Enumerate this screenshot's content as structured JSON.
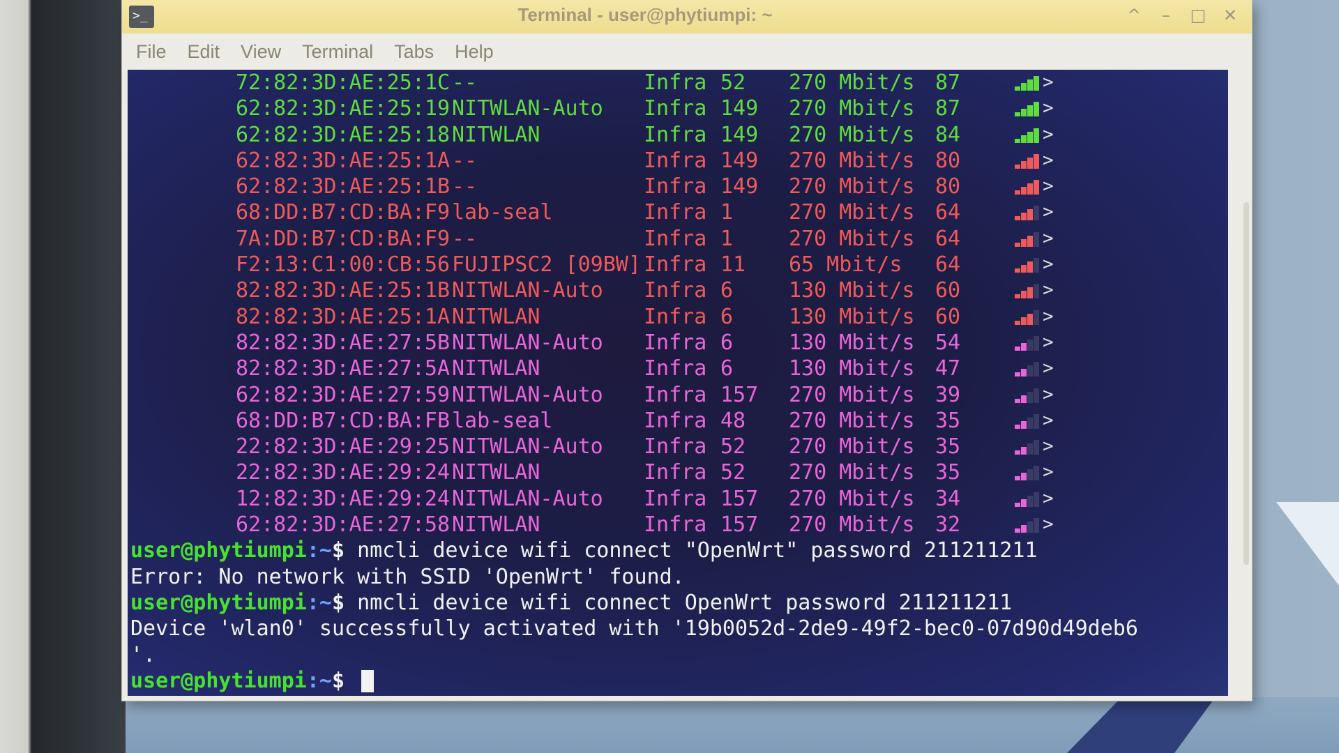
{
  "window": {
    "title": "Terminal - user@phytiumpi: ~",
    "icon_glyph": ">_",
    "controls": [
      "^",
      "–",
      "□",
      "✕"
    ]
  },
  "menu": [
    "File",
    "Edit",
    "View",
    "Terminal",
    "Tabs",
    "Help"
  ],
  "scan_rows": [
    {
      "bssid": "72:82:3D:AE:25:1C",
      "ssid": "--",
      "mode": "Infra",
      "chan": "52",
      "rate": "270 Mbit/s",
      "signal": "87",
      "color": "green"
    },
    {
      "bssid": "62:82:3D:AE:25:19",
      "ssid": "NITWLAN-Auto",
      "mode": "Infra",
      "chan": "149",
      "rate": "270 Mbit/s",
      "signal": "87",
      "color": "green"
    },
    {
      "bssid": "62:82:3D:AE:25:18",
      "ssid": "NITWLAN",
      "mode": "Infra",
      "chan": "149",
      "rate": "270 Mbit/s",
      "signal": "84",
      "color": "green"
    },
    {
      "bssid": "62:82:3D:AE:25:1A",
      "ssid": "--",
      "mode": "Infra",
      "chan": "149",
      "rate": "270 Mbit/s",
      "signal": "80",
      "color": "red"
    },
    {
      "bssid": "62:82:3D:AE:25:1B",
      "ssid": "--",
      "mode": "Infra",
      "chan": "149",
      "rate": "270 Mbit/s",
      "signal": "80",
      "color": "red"
    },
    {
      "bssid": "68:DD:B7:CD:BA:F9",
      "ssid": "lab-seal",
      "mode": "Infra",
      "chan": "1",
      "rate": "270 Mbit/s",
      "signal": "64",
      "color": "red"
    },
    {
      "bssid": "7A:DD:B7:CD:BA:F9",
      "ssid": "--",
      "mode": "Infra",
      "chan": "1",
      "rate": "270 Mbit/s",
      "signal": "64",
      "color": "red"
    },
    {
      "bssid": "F2:13:C1:00:CB:56",
      "ssid": "FUJIPSC2 [09BW]",
      "mode": "Infra",
      "chan": "11",
      "rate": "65 Mbit/s",
      "signal": "64",
      "color": "red"
    },
    {
      "bssid": "82:82:3D:AE:25:1B",
      "ssid": "NITWLAN-Auto",
      "mode": "Infra",
      "chan": "6",
      "rate": "130 Mbit/s",
      "signal": "60",
      "color": "red"
    },
    {
      "bssid": "82:82:3D:AE:25:1A",
      "ssid": "NITWLAN",
      "mode": "Infra",
      "chan": "6",
      "rate": "130 Mbit/s",
      "signal": "60",
      "color": "red"
    },
    {
      "bssid": "82:82:3D:AE:27:5B",
      "ssid": "NITWLAN-Auto",
      "mode": "Infra",
      "chan": "6",
      "rate": "130 Mbit/s",
      "signal": "54",
      "color": "magenta"
    },
    {
      "bssid": "82:82:3D:AE:27:5A",
      "ssid": "NITWLAN",
      "mode": "Infra",
      "chan": "6",
      "rate": "130 Mbit/s",
      "signal": "47",
      "color": "magenta"
    },
    {
      "bssid": "62:82:3D:AE:27:59",
      "ssid": "NITWLAN-Auto",
      "mode": "Infra",
      "chan": "157",
      "rate": "270 Mbit/s",
      "signal": "39",
      "color": "magenta"
    },
    {
      "bssid": "68:DD:B7:CD:BA:FB",
      "ssid": "lab-seal",
      "mode": "Infra",
      "chan": "48",
      "rate": "270 Mbit/s",
      "signal": "35",
      "color": "magenta"
    },
    {
      "bssid": "22:82:3D:AE:29:25",
      "ssid": "NITWLAN-Auto",
      "mode": "Infra",
      "chan": "52",
      "rate": "270 Mbit/s",
      "signal": "35",
      "color": "magenta"
    },
    {
      "bssid": "22:82:3D:AE:29:24",
      "ssid": "NITWLAN",
      "mode": "Infra",
      "chan": "52",
      "rate": "270 Mbit/s",
      "signal": "35",
      "color": "magenta"
    },
    {
      "bssid": "12:82:3D:AE:29:24",
      "ssid": "NITWLAN-Auto",
      "mode": "Infra",
      "chan": "157",
      "rate": "270 Mbit/s",
      "signal": "34",
      "color": "magenta"
    },
    {
      "bssid": "62:82:3D:AE:27:58",
      "ssid": "NITWLAN",
      "mode": "Infra",
      "chan": "157",
      "rate": "270 Mbit/s",
      "signal": "32",
      "color": "magenta"
    }
  ],
  "prompt": {
    "user": "user@phytiumpi",
    "path": ":~",
    "symbol": "$ "
  },
  "session": [
    {
      "type": "cmd",
      "text": "nmcli device wifi connect \"OpenWrt\" password 211211211"
    },
    {
      "type": "out",
      "text": "Error: No network with SSID 'OpenWrt' found."
    },
    {
      "type": "cmd",
      "text": "nmcli device wifi connect OpenWrt password 211211211"
    },
    {
      "type": "out",
      "text": "Device 'wlan0' successfully activated with '19b0052d-2de9-49f2-bec0-07d90d49deb6"
    },
    {
      "type": "out",
      "text": "'."
    },
    {
      "type": "cmd",
      "text": ""
    }
  ],
  "colors": {
    "green": "#5fdc3e",
    "red": "#ef5a5a",
    "magenta": "#e866d8",
    "prompt_user": "#47e22d",
    "prompt_path": "#6fa2ff"
  }
}
